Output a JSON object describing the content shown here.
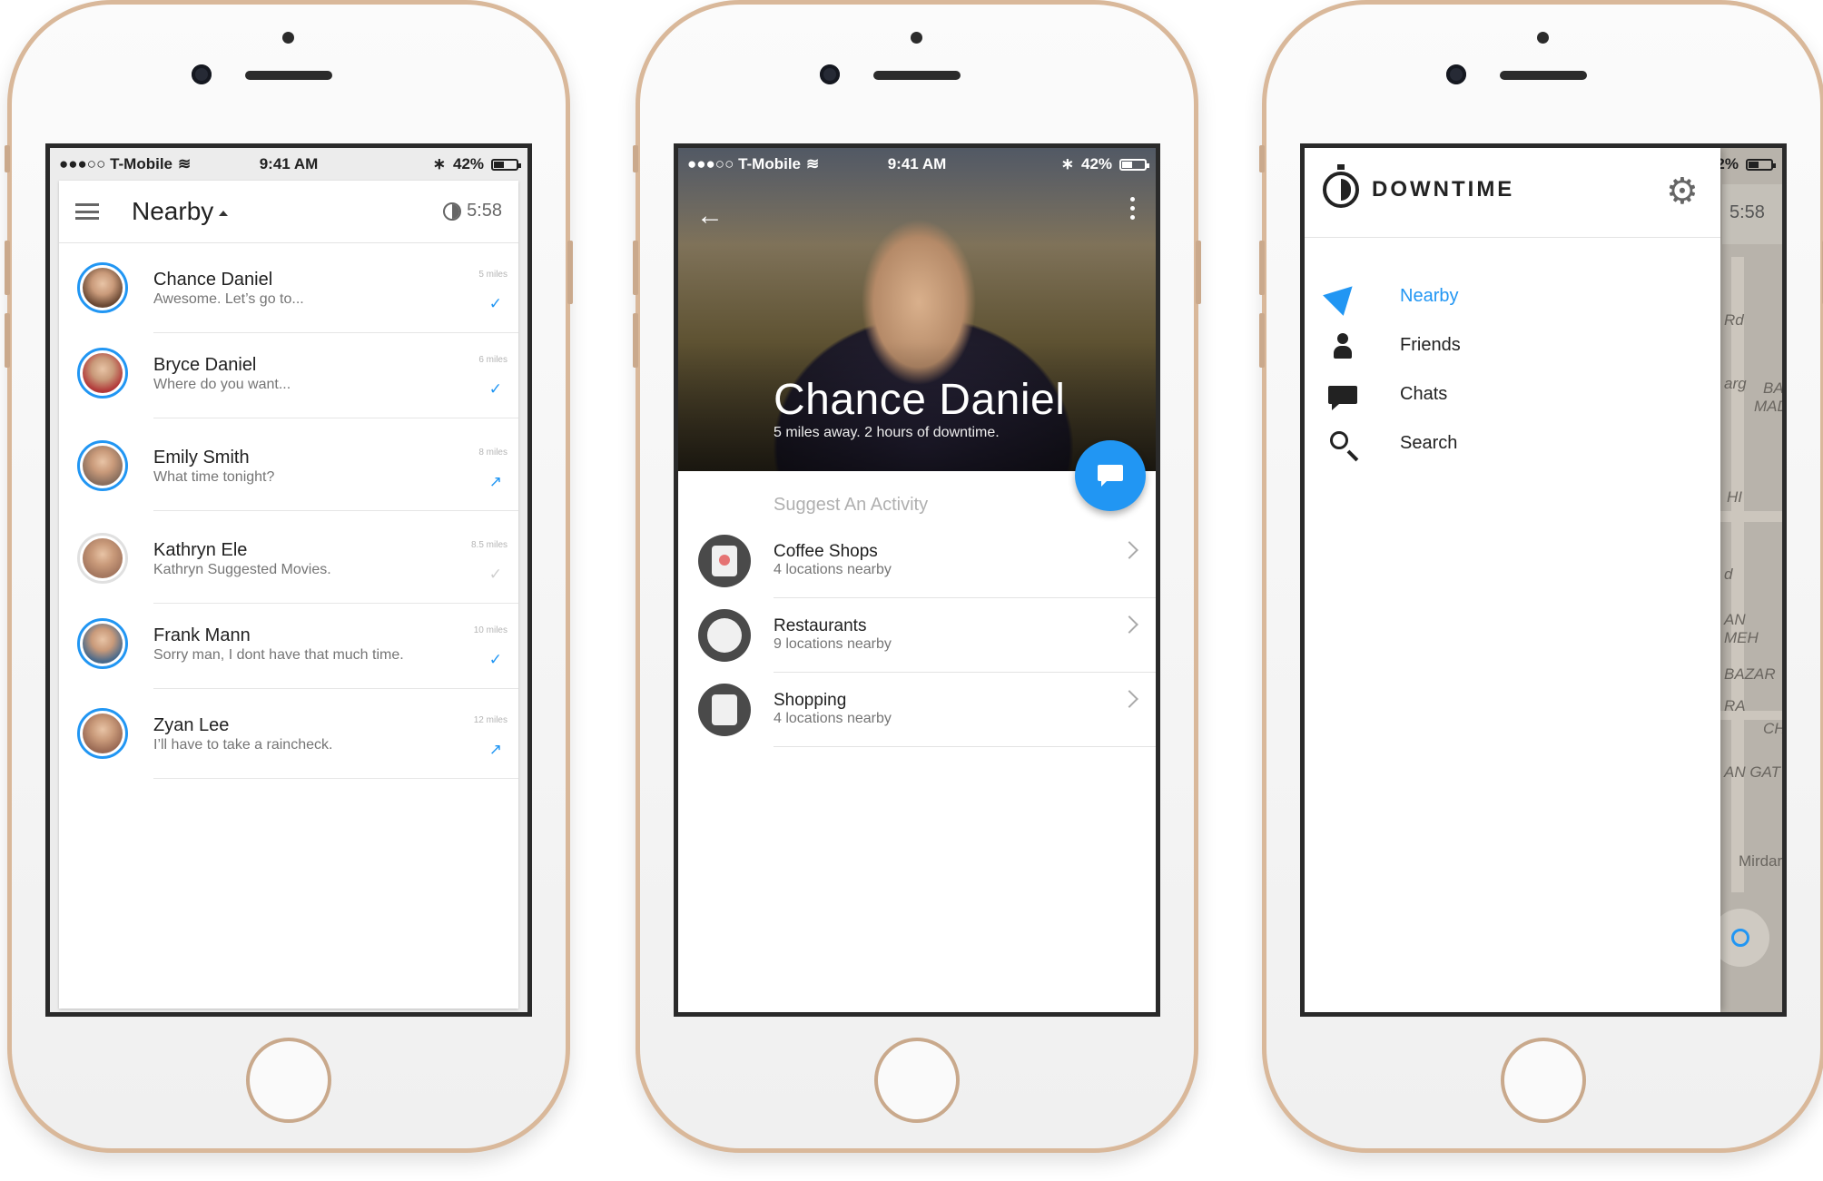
{
  "status": {
    "carrier": "●●●○○ T-Mobile",
    "time": "9:41 AM",
    "battery": "42%"
  },
  "screen1": {
    "title": "Nearby",
    "timer": "5:58",
    "contacts": [
      {
        "name": "Chance Daniel",
        "message": "Awesome. Let’s go to...",
        "distance": "5 miles",
        "status": "read",
        "status_icon": "✓",
        "avatar_color": "#6b4a35"
      },
      {
        "name": "Bryce Daniel",
        "message": "Where do you want...",
        "distance": "6 miles",
        "status": "read",
        "status_icon": "✓",
        "avatar_color": "#b23a3a"
      },
      {
        "name": "Emily Smith",
        "message": "What time tonight?",
        "distance": "8 miles",
        "status": "forwarded",
        "status_icon": "↗",
        "avatar_color": "#8a6f5e"
      },
      {
        "name": "Kathryn Ele",
        "message": "Kathryn Suggested Movies.",
        "distance": "8.5 miles",
        "status": "pending",
        "status_icon": "✓",
        "avatar_color": "#a57860"
      },
      {
        "name": "Frank Mann",
        "message": "Sorry man, I dont have that much time.",
        "distance": "10 miles",
        "status": "read",
        "status_icon": "✓",
        "avatar_color": "#4b6a8a"
      },
      {
        "name": "Zyan Lee",
        "message": "I’ll have to take a raincheck.",
        "distance": "12 miles",
        "status": "forwarded",
        "status_icon": "↗",
        "avatar_color": "#9b6b55"
      }
    ],
    "colors": {
      "accent": "#2196f3"
    }
  },
  "screen2": {
    "name": "Chance Daniel",
    "subtitle": "5 miles away. 2 hours of downtime.",
    "section_title": "Suggest An Activity",
    "activities": [
      {
        "title": "Coffee Shops",
        "subtitle": "4 locations nearby",
        "icon": "coffee-cup-icon"
      },
      {
        "title": "Restaurants",
        "subtitle": "9 locations nearby",
        "icon": "plate-icon"
      },
      {
        "title": "Shopping",
        "subtitle": "4 locations nearby",
        "icon": "shopping-bag-icon"
      }
    ]
  },
  "screen3": {
    "brand": "DOWNTIME",
    "nav": [
      {
        "label": "Nearby",
        "icon": "navigation-arrow-icon",
        "active": true
      },
      {
        "label": "Friends",
        "icon": "person-icon",
        "active": false
      },
      {
        "label": "Chats",
        "icon": "chat-bubble-icon",
        "active": false
      },
      {
        "label": "Search",
        "icon": "search-icon",
        "active": false
      }
    ],
    "map_timer": "5:58",
    "map_labels": [
      "Rd",
      "arg",
      "BA",
      "MAD",
      "HI",
      "d",
      "AN MEH",
      "BAZAR",
      "RA",
      "CH",
      "AN GAT",
      "Mirdar"
    ]
  }
}
